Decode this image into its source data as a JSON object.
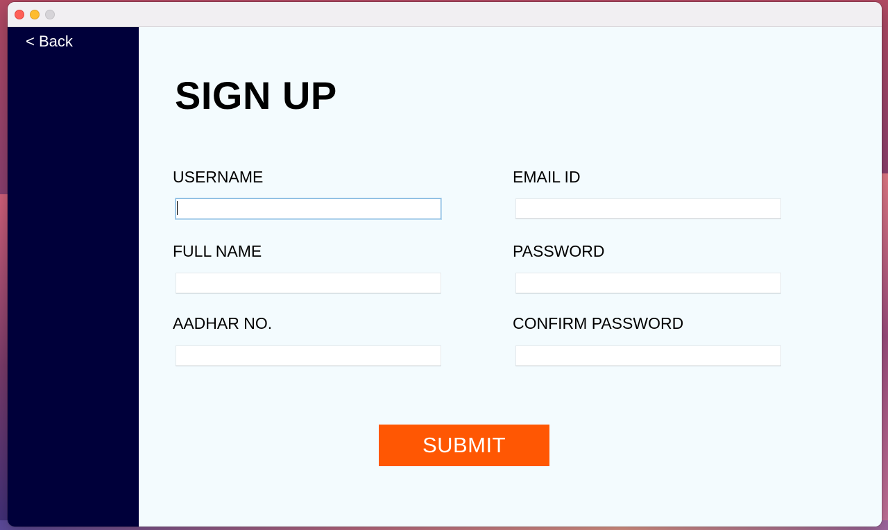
{
  "sidebar": {
    "back_label": "< Back"
  },
  "form": {
    "title": "SIGN UP",
    "fields": {
      "username": {
        "label": "USERNAME",
        "value": ""
      },
      "email": {
        "label": "EMAIL ID",
        "value": ""
      },
      "full_name": {
        "label": "FULL NAME",
        "value": ""
      },
      "password": {
        "label": "PASSWORD",
        "value": ""
      },
      "aadhar": {
        "label": "AADHAR NO.",
        "value": ""
      },
      "confirm_password": {
        "label": "CONFIRM PASSWORD",
        "value": ""
      }
    },
    "submit_label": "SUBMIT"
  },
  "colors": {
    "sidebar": "#00003a",
    "accent": "#ff5703",
    "background": "#f3fbfe"
  }
}
